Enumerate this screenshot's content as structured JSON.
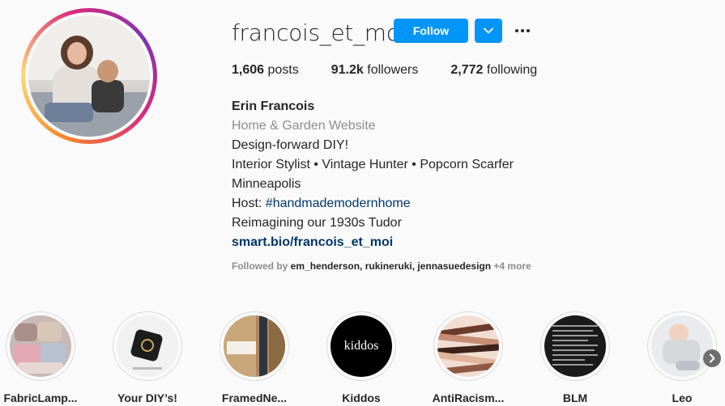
{
  "profile": {
    "username": "francois_et_moi",
    "follow_label": "Follow",
    "stats": {
      "posts_count": "1,606",
      "posts_label": "posts",
      "followers_count": "91.2k",
      "followers_label": "followers",
      "following_count": "2,772",
      "following_label": "following"
    },
    "bio": {
      "name": "Erin Francois",
      "category": "Home & Garden Website",
      "lines": [
        "Design-forward DIY!",
        "Interior Stylist • Vintage Hunter • Popcorn Scarfer",
        "Minneapolis"
      ],
      "host_prefix": "Host: ",
      "hashtag": "#handmademodernhome",
      "line_last": "Reimagining our 1930s Tudor",
      "link": "smart.bio/francois_et_moi"
    },
    "followed_by": {
      "label": "Followed by ",
      "names": "em_henderson, rukineruki, jennasuedesign",
      "more": " +4 more"
    }
  },
  "highlights": [
    {
      "label": "FabricLamp...",
      "icon": "fabric-lamps-thumbnail"
    },
    {
      "label": "Your DIY’s!",
      "icon": "your-diys-thumbnail"
    },
    {
      "label": "FramedNe...",
      "icon": "framed-news-thumbnail"
    },
    {
      "label": "Kiddos",
      "icon": "kiddos-thumbnail",
      "thumb_text": "kiddos"
    },
    {
      "label": "AntiRacism...",
      "icon": "antiracism-thumbnail"
    },
    {
      "label": "BLM",
      "icon": "blm-thumbnail"
    },
    {
      "label": "Leo",
      "icon": "leo-thumbnail"
    }
  ],
  "colors": {
    "accent": "#0095f6",
    "text": "#262626",
    "muted": "#8e8e8e",
    "link": "#00376b",
    "background": "#fafafa"
  }
}
